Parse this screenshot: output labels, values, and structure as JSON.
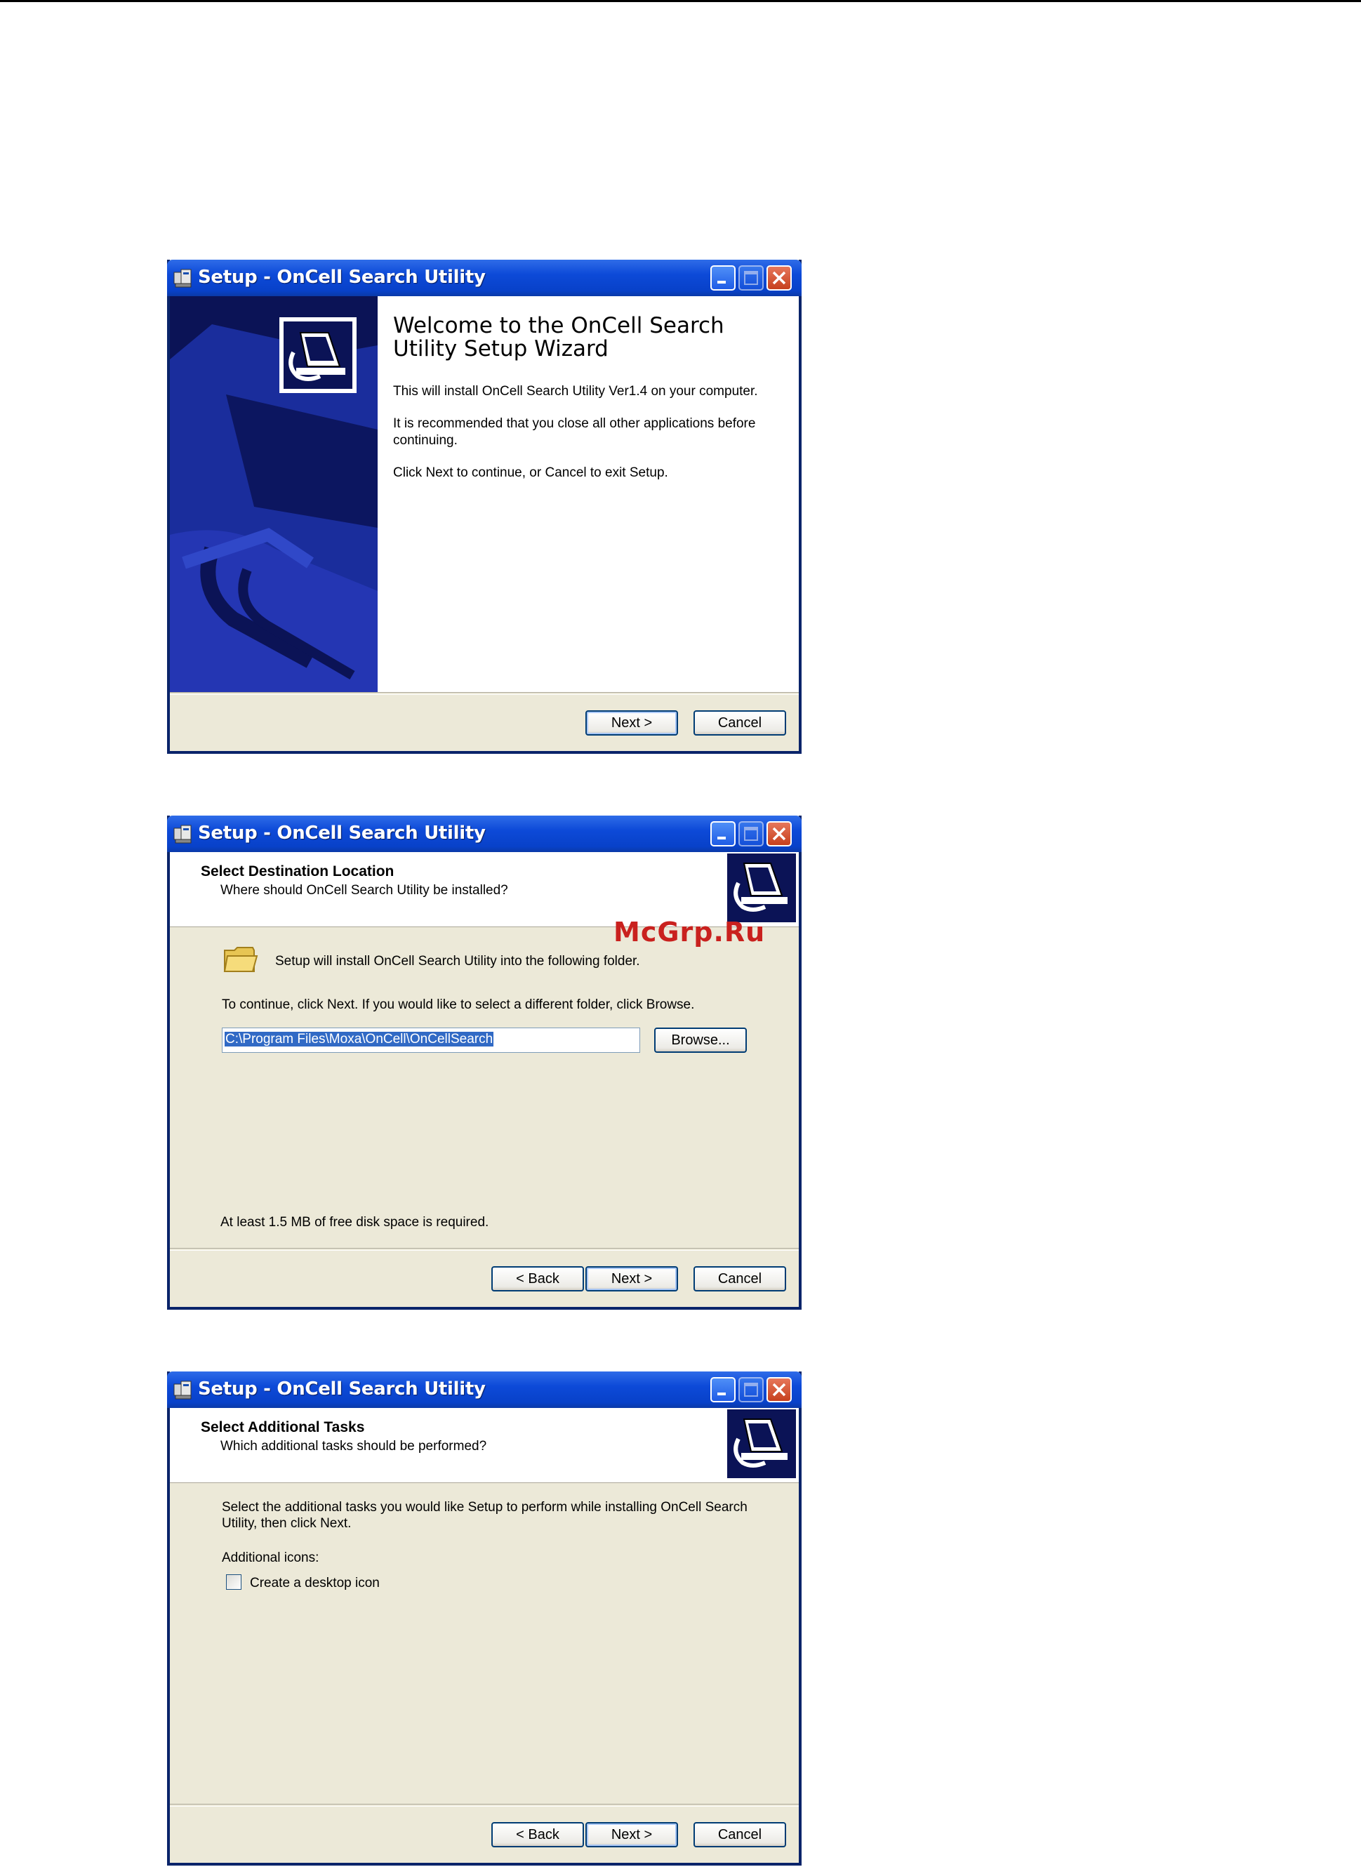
{
  "watermark": "McGrp.Ru",
  "welcome": {
    "title": "Setup - OnCell Search Utility",
    "heading": "Welcome to the OnCell Search Utility Setup Wizard",
    "para1": "This will install OnCell Search Utility Ver1.4 on your computer.",
    "para2": "It is recommended that you close all other applications before continuing.",
    "para3": "Click Next to continue, or Cancel to exit Setup.",
    "next_label": "Next >",
    "cancel_label": "Cancel"
  },
  "destination": {
    "title": "Setup - OnCell Search Utility",
    "header_title": "Select Destination Location",
    "header_sub": "Where should OnCell Search Utility be installed?",
    "install_text": "Setup will install OnCell Search Utility into the following folder.",
    "continue_text": "To continue, click Next. If you would like to select a different folder, click Browse.",
    "path_value": "C:\\Program Files\\Moxa\\OnCell\\OnCellSearch",
    "browse_label": "Browse...",
    "disk_space": "At least 1.5 MB of free disk space is required.",
    "back_label": "< Back",
    "next_label": "Next >",
    "cancel_label": "Cancel"
  },
  "tasks": {
    "title": "Setup - OnCell Search Utility",
    "header_title": "Select Additional Tasks",
    "header_sub": "Which additional tasks should be performed?",
    "instructions": "Select the additional tasks you would like Setup to perform while installing OnCell Search Utility, then click Next.",
    "group_label": "Additional icons:",
    "checkbox_label": "Create a desktop icon",
    "checkbox_checked": false,
    "back_label": "< Back",
    "next_label": "Next >",
    "cancel_label": "Cancel"
  }
}
